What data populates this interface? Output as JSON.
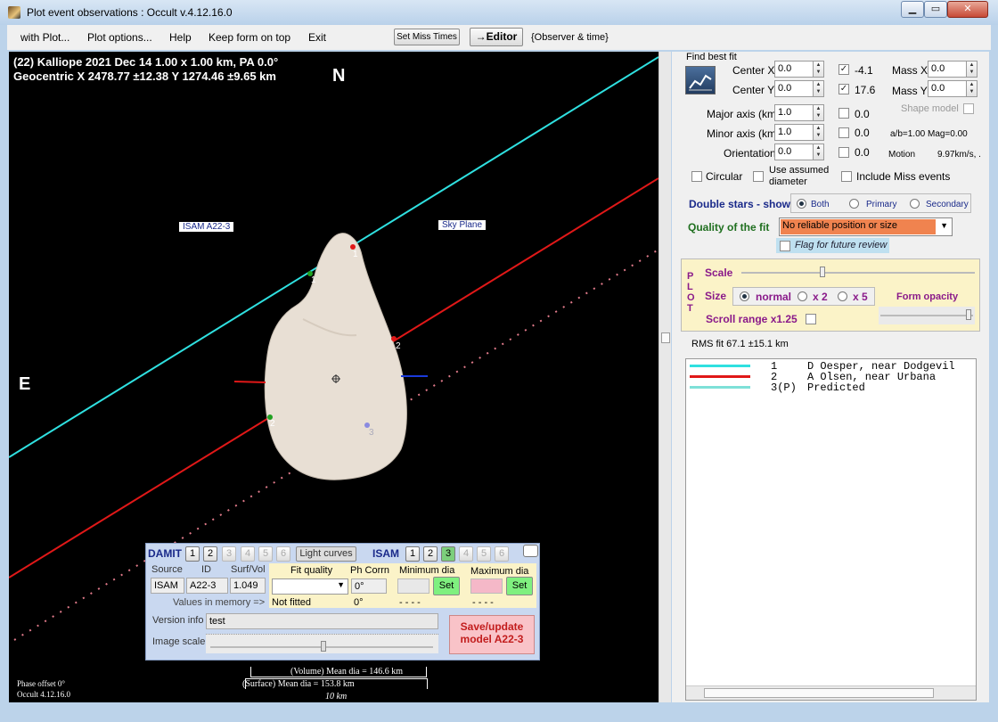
{
  "window": {
    "title": "Plot event observations : Occult v.4.12.16.0"
  },
  "menubar": {
    "items": [
      "with Plot...",
      "Plot options...",
      "Help",
      "Keep form on top",
      "Exit"
    ],
    "set_miss_times": "Set Miss Times",
    "editor": "→Editor",
    "observer_time": "{Observer & time}"
  },
  "plot": {
    "header_line1": "(22) Kalliope  2021 Dec 14   1.00 x 1.00 km, PA 0.0°",
    "header_line2": "Geocentric  X 2478.77 ±12.38  Y 1274.46 ±9.65 km",
    "north": "N",
    "east": "E",
    "isam_tag": "ISAM A22-3",
    "sky_plane_tag": "Sky Plane",
    "chord_labels": [
      "1",
      "1",
      "2",
      "2",
      "3"
    ],
    "phase_offset": "Phase offset 0°",
    "version": "Occult 4.12.16.0",
    "volume_dia": "(Volume) Mean dia = 146.6 km",
    "surface_dia": "(Surface) Mean dia = 153.8 km",
    "scale_label": "10 km",
    "colors": {
      "observer1": "#2fe0e0",
      "observer2": "#e01818",
      "predicted": "#e07a8a",
      "asteroid": "#e8dfd4"
    }
  },
  "damit": {
    "title": "DAMIT",
    "isam_title": "ISAM",
    "damit_buttons": [
      "1",
      "2",
      "3",
      "4",
      "5",
      "6"
    ],
    "light_curves": "Light curves",
    "isam_buttons": [
      "1",
      "2",
      "3",
      "4",
      "5",
      "6"
    ],
    "source_label": "Source",
    "id_label": "ID",
    "surf_vol_label": "Surf/Vol",
    "source_value": "ISAM",
    "id_value": "A22-3",
    "surf_vol_value": "1.049",
    "fit_quality_label": "Fit quality",
    "ph_corrn_label": "Ph Corrn",
    "min_dia_label": "Minimum dia",
    "max_dia_label": "Maximum dia",
    "ph_corrn_value": "0°",
    "set": "Set",
    "values_in_memory": "Values in memory =>",
    "not_fitted": "Not fitted",
    "ph_value2": "0°",
    "dashes1": "- - - -",
    "dashes2": "- - - -",
    "version_info_label": "Version info",
    "version_info_value": "test",
    "image_scale_label": "Image scale",
    "save_button": "Save/update model A22-3"
  },
  "fit": {
    "find_best_fit": "Find best fit",
    "center_x_label": "Center X",
    "center_x": "0.0",
    "center_x_result": "-4.1",
    "center_y_label": "Center Y",
    "center_y": "0.0",
    "center_y_result": "17.6",
    "mass_x_label": "Mass X",
    "mass_x": "0.0",
    "mass_y_label": "Mass Y",
    "mass_y": "0.0",
    "major_axis_label": "Major axis (km)",
    "major_axis": "1.0",
    "major_axis_result": "0.0",
    "minor_axis_label": "Minor axis (km)",
    "minor_axis": "1.0",
    "minor_axis_result": "0.0",
    "orientation_label": "Orientation",
    "orientation": "0.0",
    "orientation_result": "0.0",
    "shape_model": "Shape model",
    "ab_ratio": "a/b=1.00  Mag=0.00",
    "motion_label": "Motion",
    "motion_value": "9.97km/s, .",
    "circular": "Circular",
    "use_assumed_diameter": "Use assumed diameter",
    "include_miss_events": "Include Miss events"
  },
  "double_stars": {
    "label": "Double stars - show",
    "options": [
      "Both",
      "Primary",
      "Secondary"
    ],
    "selected": "Both"
  },
  "quality": {
    "label": "Quality of the fit",
    "value": "No reliable position or size",
    "flag_review": "Flag for future review"
  },
  "plot_controls": {
    "plot_letters": [
      "P",
      "L",
      "O",
      "T"
    ],
    "scale_label": "Scale",
    "size_label": "Size",
    "size_options": [
      "normal",
      "x 2",
      "x 5"
    ],
    "size_selected": "normal",
    "form_opacity": "Form opacity",
    "scroll_range": "Scroll range x1.25"
  },
  "rms_fit": "RMS fit 67.1 ±15.1 km",
  "legend": [
    {
      "num": "1",
      "name": "D Oesper, near Dodgevil",
      "color": "#2fe0e0"
    },
    {
      "num": "2",
      "name": "A Olsen, near Urbana",
      "color": "#e01818"
    },
    {
      "num": "3(P)",
      "name": "Predicted",
      "color": "#7ee0d8"
    }
  ]
}
